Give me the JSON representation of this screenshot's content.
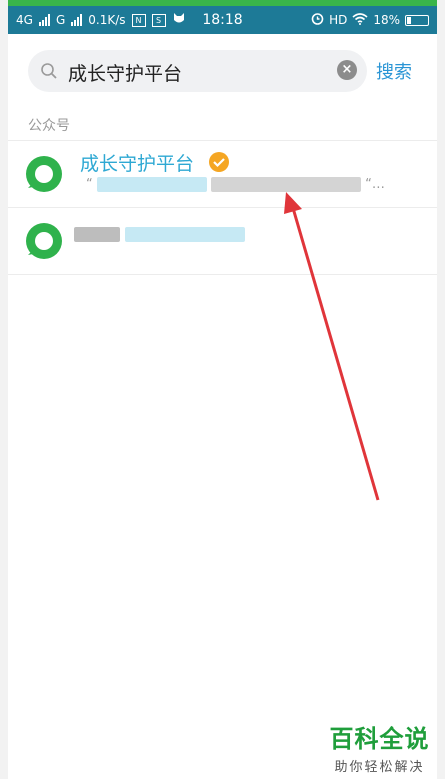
{
  "status_bar": {
    "network_1": "4G",
    "network_2": "G",
    "speed": "0.1K/s",
    "box_1": "N",
    "box_2": "S",
    "time": "18:18",
    "hd": "HD",
    "battery": "18%",
    "battery_level": 0.18
  },
  "search": {
    "query": "成长守护平台",
    "button_label": "搜索"
  },
  "section": {
    "label": "公众号"
  },
  "results": [
    {
      "title": "成长守护平台",
      "desc_start": "“",
      "desc_end": "“…"
    }
  ],
  "watermark": {
    "main": "百科全说",
    "sub": "助你轻松解决"
  },
  "colors": {
    "status_bar": "#1d7a97",
    "accent": "#2a95d5",
    "title_blue": "#2ea8d3",
    "avatar_green": "#2fb24c",
    "verified_orange": "#f5a623",
    "arrow_red": "#e0353a",
    "watermark_green": "#1f9e3b"
  }
}
